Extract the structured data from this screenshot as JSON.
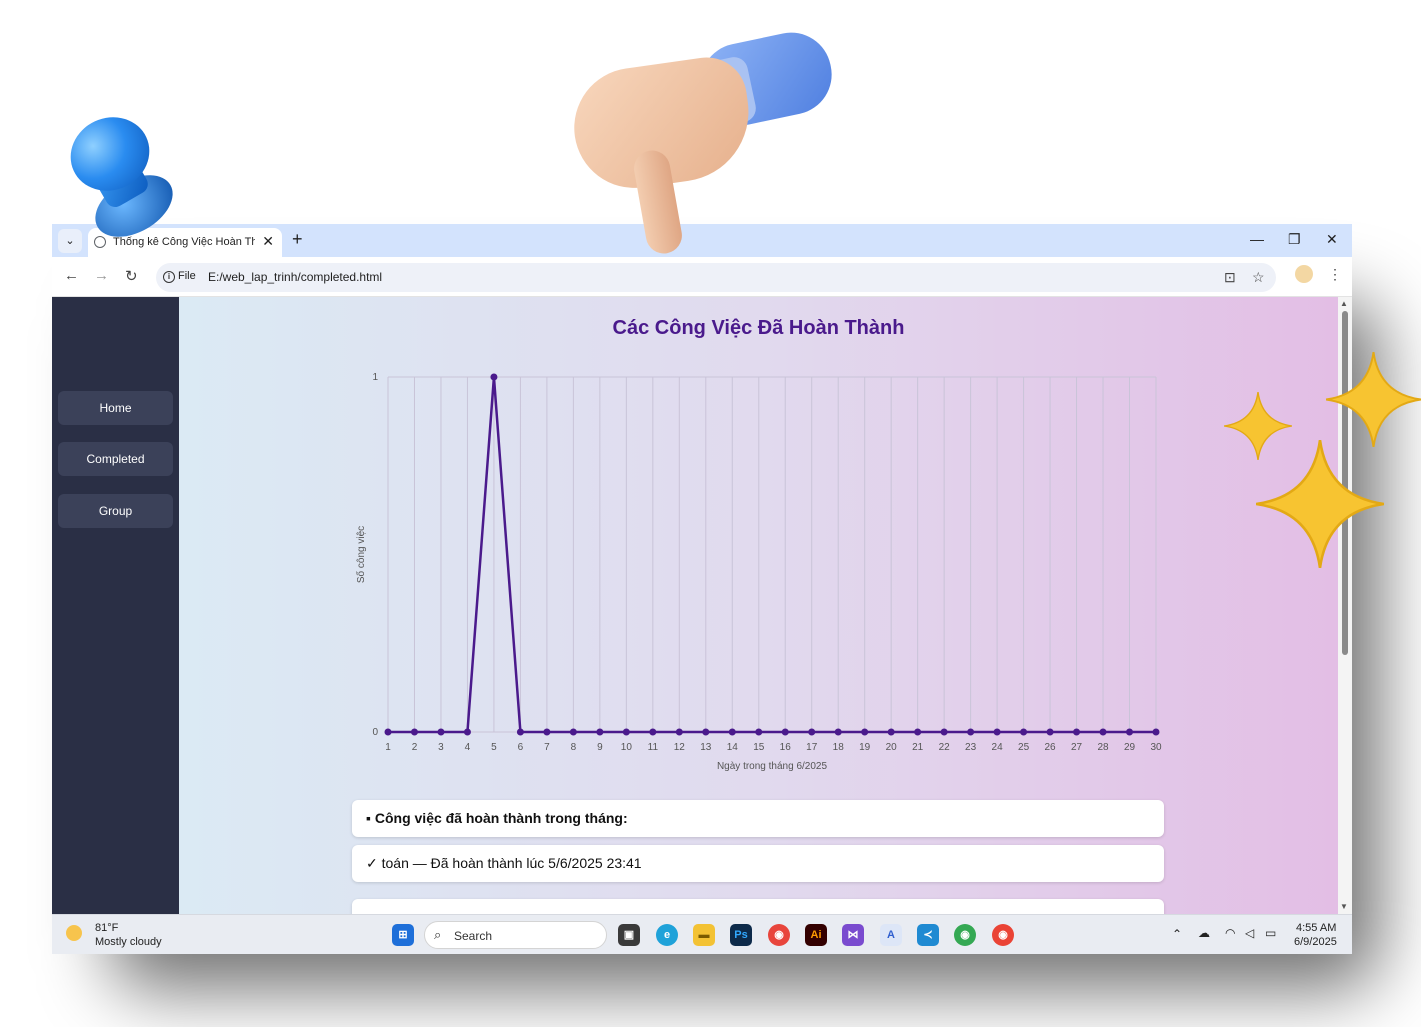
{
  "browser": {
    "tab_title": "Thống kê Công Việc Hoàn Thành",
    "url_scheme_label": "File",
    "url": "E:/web_lap_trinh/completed.html"
  },
  "sidebar": {
    "items": [
      {
        "label": "Home"
      },
      {
        "label": "Completed"
      },
      {
        "label": "Group"
      }
    ]
  },
  "page": {
    "title": "Các Công Việc Đã Hoàn Thành"
  },
  "chart_data": {
    "type": "line",
    "x": [
      1,
      2,
      3,
      4,
      5,
      6,
      7,
      8,
      9,
      10,
      11,
      12,
      13,
      14,
      15,
      16,
      17,
      18,
      19,
      20,
      21,
      22,
      23,
      24,
      25,
      26,
      27,
      28,
      29,
      30
    ],
    "values": [
      0,
      0,
      0,
      0,
      1,
      0,
      0,
      0,
      0,
      0,
      0,
      0,
      0,
      0,
      0,
      0,
      0,
      0,
      0,
      0,
      0,
      0,
      0,
      0,
      0,
      0,
      0,
      0,
      0,
      0
    ],
    "yticks": [
      0,
      1
    ],
    "ylim": [
      0,
      1
    ],
    "xlabel": "Ngày trong tháng 6/2025",
    "ylabel": "Số công việc",
    "grid": true,
    "line_color": "#4a1a8c"
  },
  "cards": [
    {
      "bullet": "▪",
      "text": "Công việc đã hoàn thành trong tháng:"
    },
    {
      "text": "✓ toán — Đã hoàn thành lúc 5/6/2025 23:41"
    }
  ],
  "taskbar": {
    "weather_temp": "81°F",
    "weather_desc": "Mostly cloudy",
    "search_placeholder": "Search",
    "time": "4:55 AM",
    "date": "6/9/2025"
  },
  "colors": {
    "sidebar_bg": "#2a2f45",
    "title_color": "#4a1a8c"
  }
}
